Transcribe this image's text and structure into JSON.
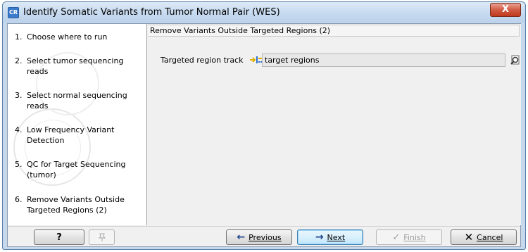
{
  "window": {
    "app_icon_text": "CR",
    "title": "Identify Somatic Variants from Tumor Normal Pair (WES)",
    "close_label": "X"
  },
  "steps": [
    {
      "num": "1.",
      "label": "Choose where to run"
    },
    {
      "num": "2.",
      "label": "Select tumor sequencing reads"
    },
    {
      "num": "3.",
      "label": "Select normal sequencing reads"
    },
    {
      "num": "4.",
      "label": "Low Frequency Variant Detection"
    },
    {
      "num": "5.",
      "label": "QC for Target Sequencing (tumor)"
    },
    {
      "num": "6.",
      "label": "Remove Variants Outside Targeted Regions (2)"
    }
  ],
  "panel": {
    "header": "Remove Variants Outside Targeted Regions (2)",
    "field_label": "Targeted region track",
    "field_value": "target regions"
  },
  "footer": {
    "help_label": "?",
    "previous_label": "Previous",
    "next_label": "Next",
    "finish_label": "Finish",
    "cancel_label": "Cancel"
  }
}
